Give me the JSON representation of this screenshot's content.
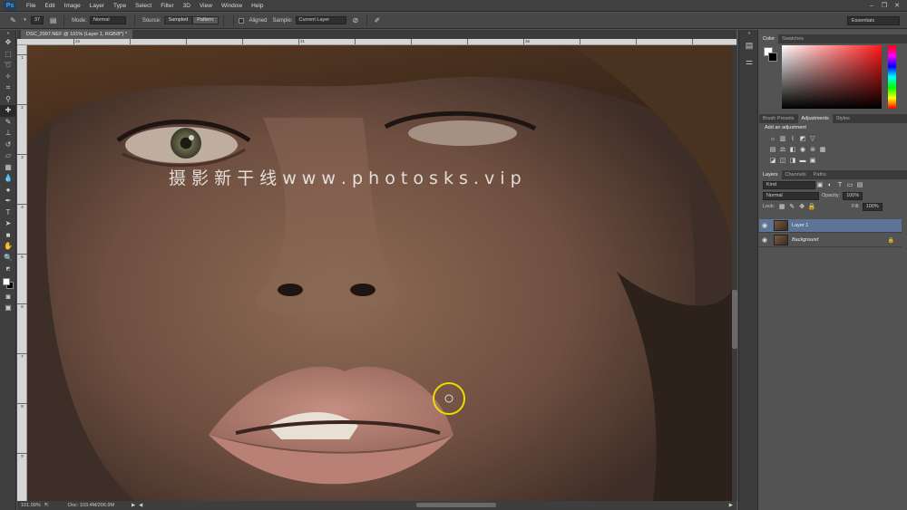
{
  "app": {
    "logo": "Ps"
  },
  "menu": [
    "File",
    "Edit",
    "Image",
    "Layer",
    "Type",
    "Select",
    "Filter",
    "3D",
    "View",
    "Window",
    "Help"
  ],
  "window_controls": [
    "–",
    "❐",
    "✕"
  ],
  "options": {
    "brush_size": "37",
    "mode_label": "Mode:",
    "mode_value": "Normal",
    "source_label": "Source:",
    "source_sampled": "Sampled",
    "source_pattern": "Pattern:",
    "aligned_label": "Aligned",
    "sample_label": "Sample:",
    "sample_value": "Current Layer",
    "workspace": "Essentials"
  },
  "document": {
    "tab_title": "DSC_2997.NEF @ 101% (Layer 1, RGB/8*) *",
    "watermark": "摄 影 新 干 线   w w w . p h o t o s k s . v i p",
    "ruler_h": [
      "25",
      "",
      "",
      "",
      "31",
      "",
      "",
      "",
      "35",
      "",
      "",
      "",
      "45"
    ],
    "ruler_v": [
      "1",
      "2",
      "3",
      "4",
      "5",
      "6",
      "7",
      "8",
      "9"
    ]
  },
  "status": {
    "zoom": "101.09%",
    "doc": "Doc: 103.4M/206.9M"
  },
  "colors": {
    "fg": "#ffffff",
    "bg": "#000000"
  },
  "panels": {
    "color_tabs": [
      "Color",
      "Swatches"
    ],
    "adj_tabs": [
      "Brush Presets",
      "Adjustments",
      "Styles"
    ],
    "adj_title": "Add an adjustment",
    "layer_tabs": [
      "Layers",
      "Channels",
      "Paths"
    ],
    "kind": "Kind",
    "blend": "Normal",
    "opacity_label": "Opacity:",
    "opacity": "100%",
    "lock_label": "Lock:",
    "fill_label": "Fill:",
    "fill": "100%",
    "layers": [
      {
        "name": "Layer 1",
        "selected": true
      },
      {
        "name": "Background",
        "selected": false,
        "locked": true
      }
    ]
  }
}
